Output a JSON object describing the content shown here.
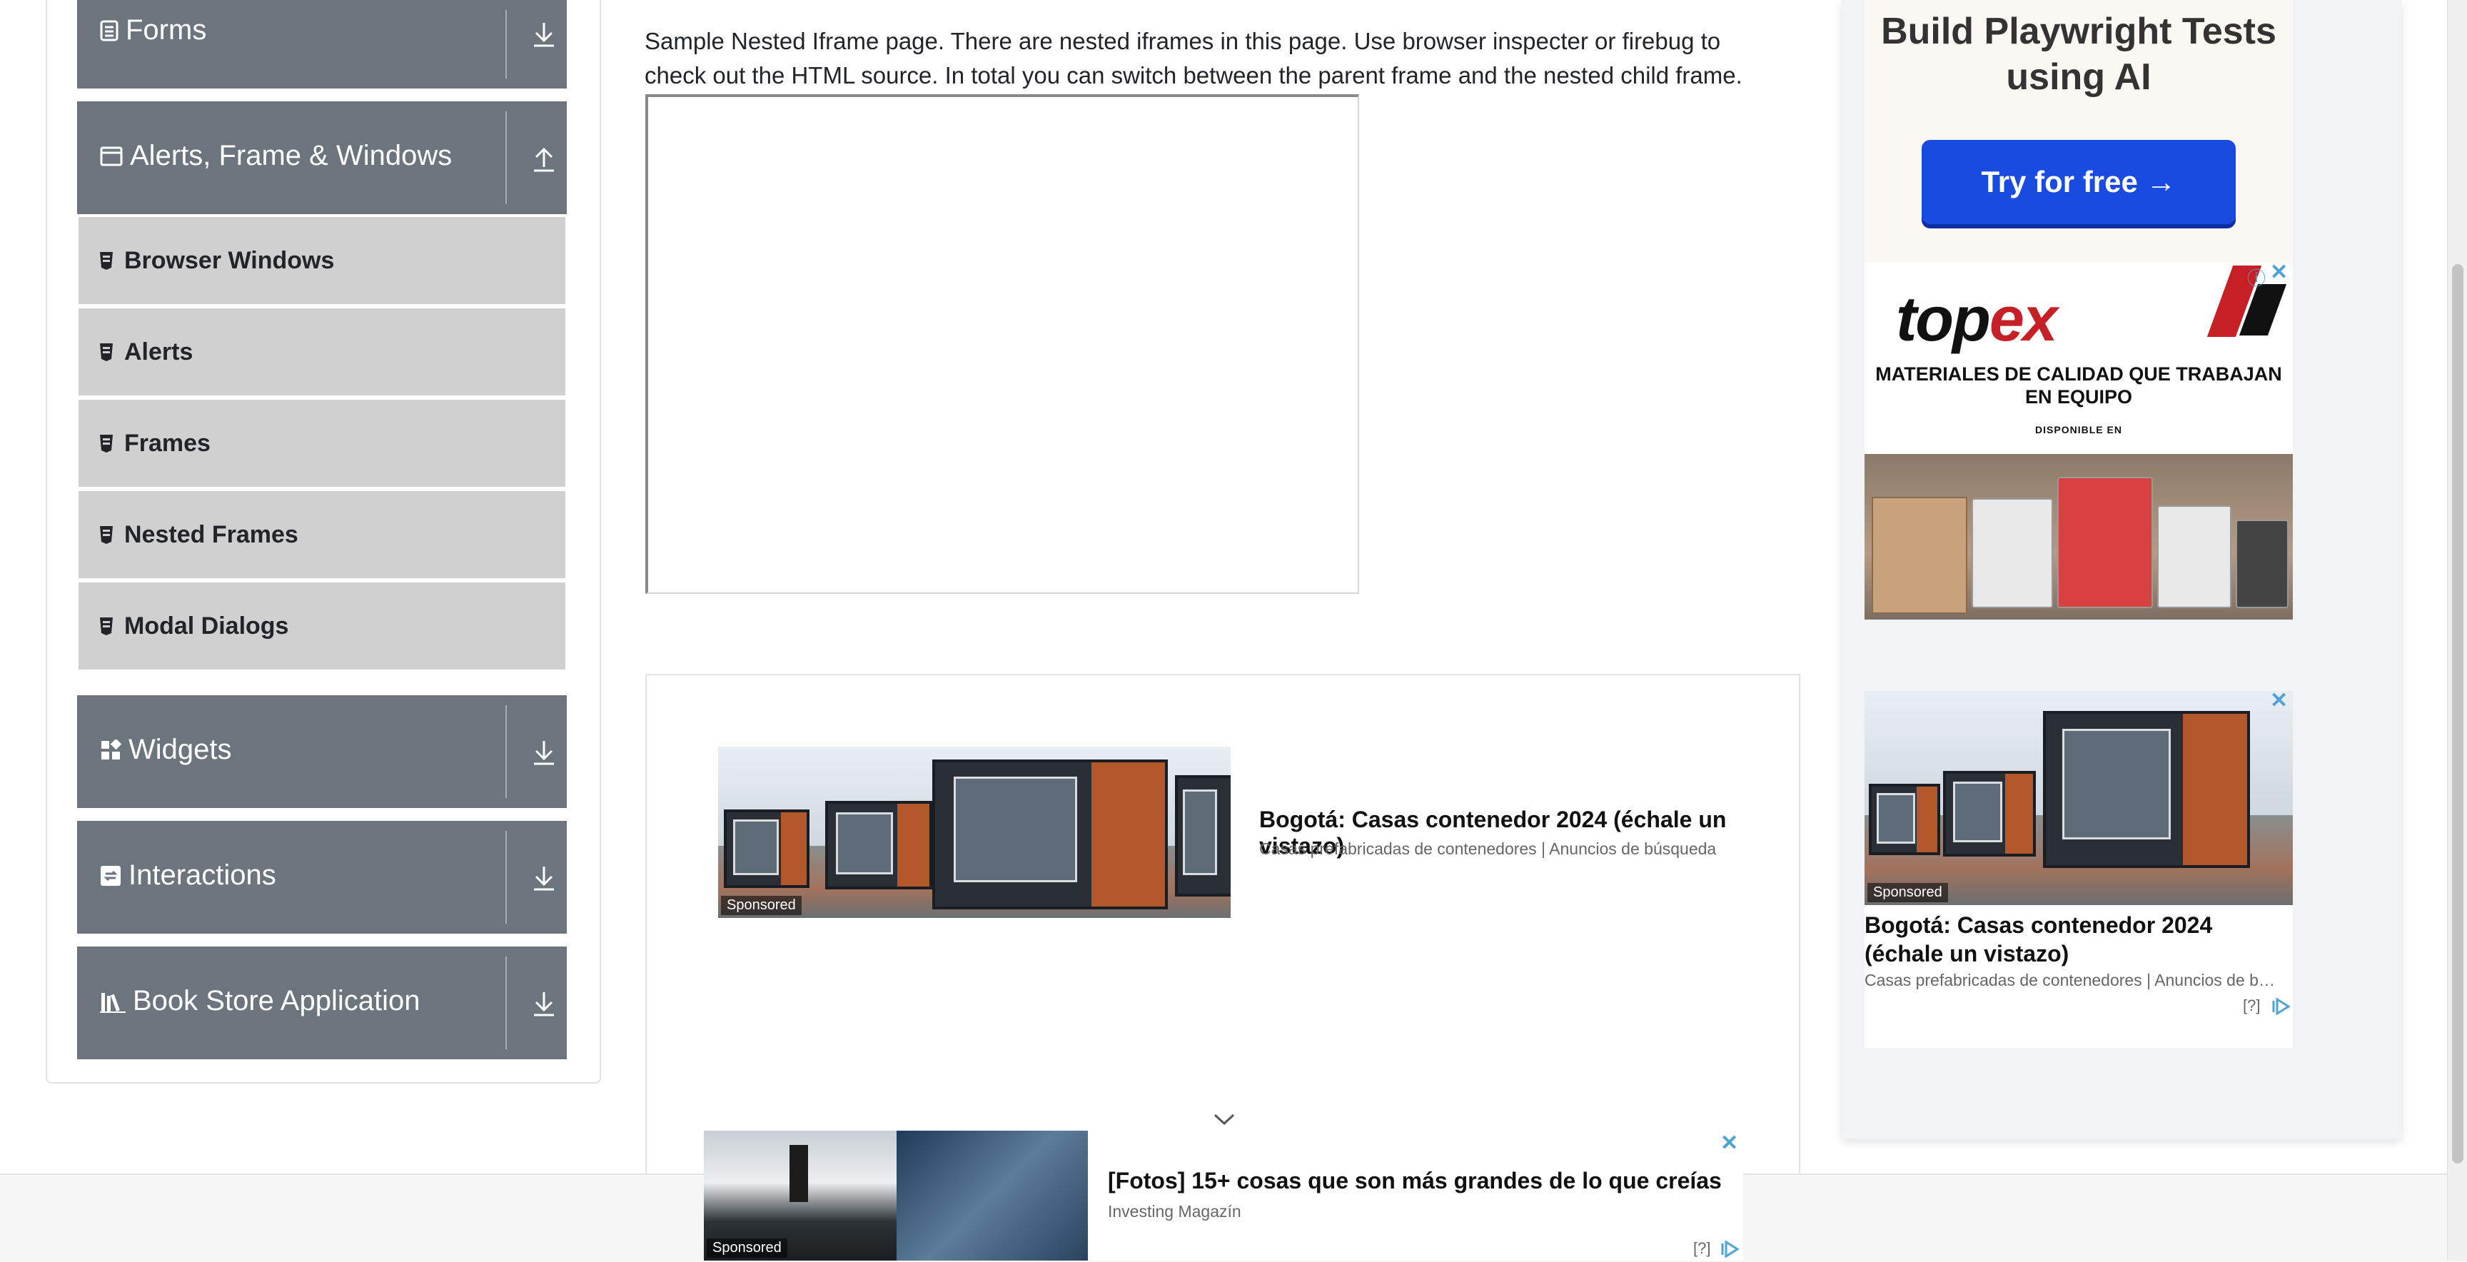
{
  "sidebar": {
    "groups": [
      {
        "label": "Forms",
        "icon": "form-icon",
        "toggle": "download-icon"
      },
      {
        "label": "Alerts, Frame & Windows",
        "icon": "window-icon",
        "toggle": "upload-icon"
      },
      {
        "label": "Widgets",
        "icon": "widgets-icon",
        "toggle": "download-icon"
      },
      {
        "label": "Interactions",
        "icon": "interactions-icon",
        "toggle": "download-icon"
      },
      {
        "label": "Book Store Application",
        "icon": "books-icon",
        "toggle": "download-icon"
      }
    ],
    "submenu": [
      {
        "label": "Browser Windows"
      },
      {
        "label": "Alerts"
      },
      {
        "label": "Frames"
      },
      {
        "label": "Nested Frames"
      },
      {
        "label": "Modal Dialogs"
      }
    ]
  },
  "main": {
    "description": "Sample Nested Iframe page. There are nested iframes in this page. Use browser inspecter or firebug to check out the HTML source. In total you can switch between the parent frame and the nested child frame."
  },
  "ads": {
    "sponsored_label": "Sponsored",
    "native_main": {
      "title": "Bogotá: Casas contenedor 2024 (échale un vistazo)",
      "source": "Casas prefabricadas de contenedores | Anuncios de búsqueda"
    },
    "playwright": {
      "title": "Build Playwright Tests using AI",
      "button": "Try for free →"
    },
    "topex": {
      "brand_a": "top",
      "brand_b": "ex",
      "tagline": "MATERIALES DE CALIDAD QUE TRABAJAN EN EQUIPO",
      "available": "DISPONIBLE EN"
    },
    "native_right": {
      "title": "Bogotá: Casas contenedor 2024 (échale un vistazo)",
      "source": "Casas prefabricadas de contenedores | Anuncios de b…",
      "help": "[?]"
    },
    "bottom": {
      "title": "[Fotos] 15+ cosas que son más grandes de lo que creías",
      "source": "Investing Magazín",
      "help": "[?]"
    }
  },
  "colors": {
    "group_bg": "#6c757d",
    "submenu_bg": "#d0d0d0",
    "ad_button": "#1a4be0",
    "ad_icon": "#4ea3d6"
  }
}
